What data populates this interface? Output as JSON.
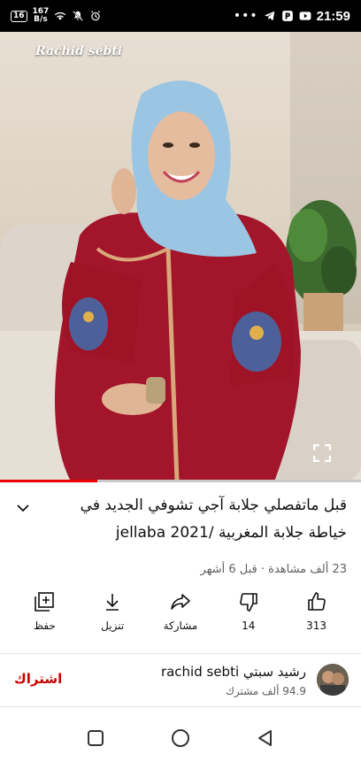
{
  "status_bar": {
    "badge": "16",
    "speed_value": "167",
    "speed_unit": "B/s",
    "time": "21:59",
    "icons": [
      "wifi-icon",
      "mute-icon",
      "alarm-icon",
      "telegram-icon",
      "parking-icon",
      "youtube-icon"
    ]
  },
  "video": {
    "watermark": "Rachid sebti",
    "progress_fraction": 0.27
  },
  "title": "قبل ماتفصلي جلابة آجي تشوفي الجديد في خياطة جلابة المغربية /jellaba 2021",
  "meta": "23 ألف مشاهدة · قبل 6 أشهر",
  "actions": {
    "like_count": "313",
    "dislike_count": "14",
    "share_label": "مشاركة",
    "download_label": "تنزيل",
    "save_label": "حفظ"
  },
  "channel": {
    "name": "رشيد سبتي rachid sebti",
    "subscribers": "94.9 ألف مشترك",
    "subscribe_label": "اشتراك"
  },
  "colors": {
    "accent": "#cc0000",
    "progress": "#ee0000"
  }
}
